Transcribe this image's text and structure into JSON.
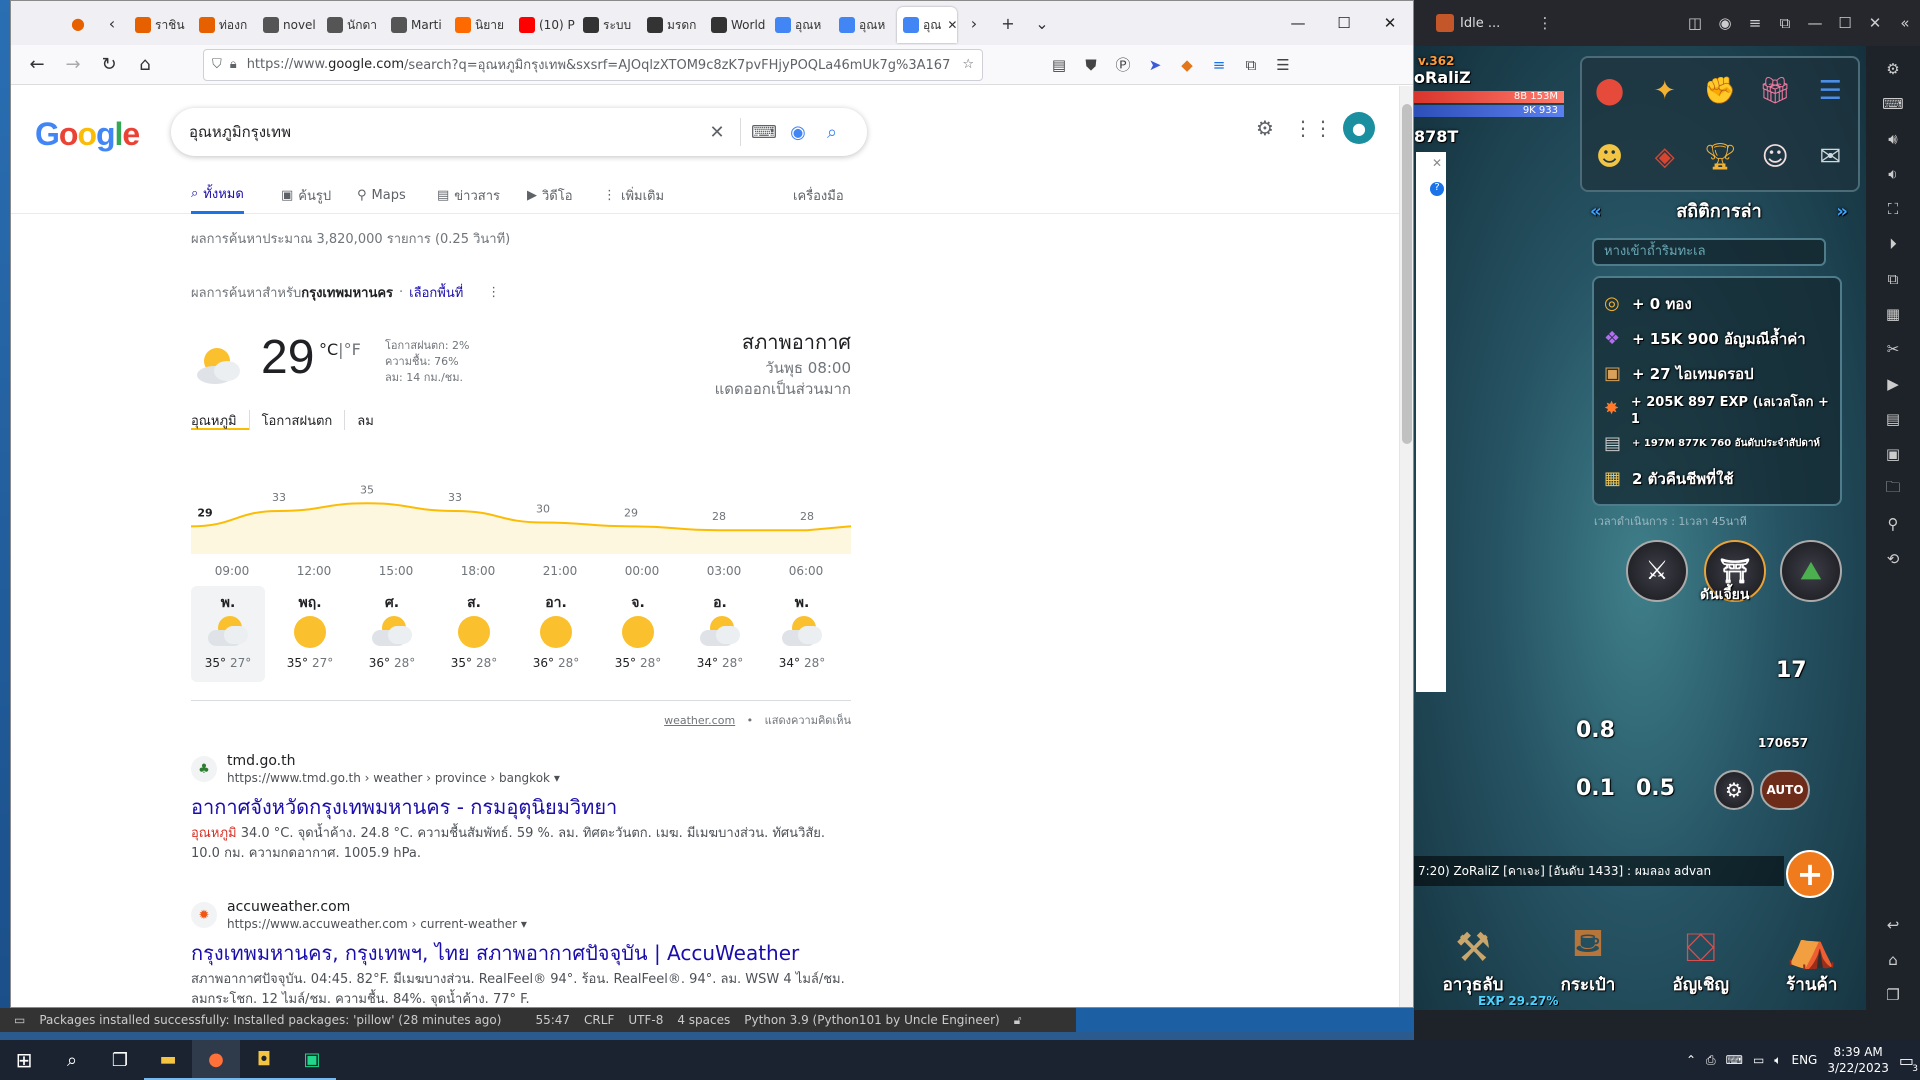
{
  "browser": {
    "tabs": [
      {
        "label": "ราชิน",
        "color": "#e66000"
      },
      {
        "label": "ท่องก",
        "color": "#e66000"
      },
      {
        "label": "novel",
        "color": "#555"
      },
      {
        "label": "นักดา",
        "color": "#555"
      },
      {
        "label": "Marti",
        "color": "#555"
      },
      {
        "label": "นิยาย",
        "color": "#ff6a00"
      },
      {
        "label": "(10) P",
        "color": "#ff0000"
      },
      {
        "label": "ระบบ",
        "color": "#333"
      },
      {
        "label": "มรดก",
        "color": "#333"
      },
      {
        "label": "World",
        "color": "#333"
      },
      {
        "label": "อุณห",
        "color": "#4285f4"
      },
      {
        "label": "อุณห",
        "color": "#4285f4"
      },
      {
        "label": "อุณ",
        "color": "#4285f4"
      }
    ],
    "url_prefix": "https://www.",
    "url_domain": "google.com",
    "url_rest": "/search?q=อุณหภูมิกรุงเทพ&sxsrf=AJOqlzXTOM9c8zK7pvFHjyPOQLa46mUk7g%3A167"
  },
  "google": {
    "logo": [
      "G",
      "o",
      "o",
      "g",
      "l",
      "e"
    ],
    "logo_colors": [
      "#4285f4",
      "#ea4335",
      "#fbbc05",
      "#4285f4",
      "#34a853",
      "#ea4335"
    ],
    "query": "อุณหภูมิกรุงเทพ",
    "tabs": [
      "ทั้งหมด",
      "ค้นรูป",
      "Maps",
      "ข่าวสาร",
      "วิดีโอ",
      "เพิ่มเติม"
    ],
    "tools": "เครื่องมือ",
    "stats": "ผลการค้นหาประมาณ 3,820,000 รายการ (0.25 วินาที)",
    "loc_prefix": "ผลการค้นหาสำหรับ",
    "loc_place": "กรุงเทพมหานคร",
    "loc_sep": "·",
    "loc_link": "เลือกพื้นที่"
  },
  "weather": {
    "temp": "29",
    "unit_c": "°C",
    "unit_sep": "|",
    "unit_f": "°F",
    "precip": "โอกาสฝนตก: 2%",
    "humidity": "ความชื้น: 76%",
    "wind": "ลม: 14 กม./ชม.",
    "title": "สภาพอากาศ",
    "day": "วันพุธ 08:00",
    "condition": "แดดออกเป็นส่วนมาก",
    "subtabs": [
      "อุณหภูมิ",
      "โอกาสฝนตก",
      "ลม"
    ],
    "source": "weather.com",
    "feedback": "แสดงความคิดเห็น",
    "days": [
      {
        "name": "พ.",
        "icon": "partly-cloudy",
        "hi": "35°",
        "lo": "27°"
      },
      {
        "name": "พฤ.",
        "icon": "sunny",
        "hi": "35°",
        "lo": "27°"
      },
      {
        "name": "ศ.",
        "icon": "partly-cloudy",
        "hi": "36°",
        "lo": "28°"
      },
      {
        "name": "ส.",
        "icon": "sunny",
        "hi": "35°",
        "lo": "28°"
      },
      {
        "name": "อา.",
        "icon": "sunny",
        "hi": "36°",
        "lo": "28°"
      },
      {
        "name": "จ.",
        "icon": "sunny",
        "hi": "35°",
        "lo": "28°"
      },
      {
        "name": "อ.",
        "icon": "partly-cloudy",
        "hi": "34°",
        "lo": "28°"
      },
      {
        "name": "พ.",
        "icon": "partly-cloudy",
        "hi": "34°",
        "lo": "28°"
      }
    ]
  },
  "chart_data": {
    "type": "area",
    "x": [
      "09:00",
      "12:00",
      "15:00",
      "18:00",
      "21:00",
      "00:00",
      "03:00",
      "06:00"
    ],
    "values": [
      29,
      33,
      35,
      33,
      30,
      29,
      28,
      28
    ],
    "ylim": [
      20,
      40
    ],
    "color": "#fbbc04"
  },
  "results": [
    {
      "site": "tmd.go.th",
      "url": "https://www.tmd.go.th › weather › province › bangkok",
      "title": "อากาศจังหวัดกรุงเทพมหานคร - กรมอุตุนิยมวิทยา",
      "snip_em": "อุณหภูมิ",
      "snippet": " 34.0 °C. จุดน้ำค้าง. 24.8 °C. ความชื้นสัมพัทธ์. 59 %. ลม. ทิศตะวันตก. เมฆ. มีเมฆบางส่วน. ทัศนวิสัย. 10.0 กม. ความกดอากาศ. 1005.9 hPa."
    },
    {
      "site": "accuweather.com",
      "url": "https://www.accuweather.com › current-weather",
      "title": "กรุงเทพมหานคร, กรุงเทพฯ, ไทย สภาพอากาศปัจจุบัน | AccuWeather",
      "snip_em": "",
      "snippet": "สภาพอากาศปัจจุบัน. 04:45. 82°F. มีเมฆบางส่วน. RealFeel® 94°. ร้อน. RealFeel®. 94°. ลม. WSW 4 ไมล์/ชม. ลมกระโชก. 12 ไมล์/ชม. ความชื้น. 84%. จุดน้ำค้าง. 77° F."
    }
  ],
  "statusbar": {
    "message": "Packages installed successfully: Installed packages: 'pillow' (28 minutes ago)",
    "position": "55:47",
    "eol": "CRLF",
    "encoding": "UTF-8",
    "indent": "4 spaces",
    "interpreter": "Python 3.9 (Python101 by Uncle Engineer)"
  },
  "emulator": {
    "title": "Idle ...",
    "level": "v.362",
    "player": "oRaliZ",
    "hp": "8B 153M",
    "mp": "9K 933",
    "power": "878T",
    "panel_title": "สถิติการล่า",
    "panel_location": "หางเข้าถ้ำริมทะเล",
    "loot": [
      "+ 0 ทอง",
      "+ 15K 900 อัญมณีล้ำค่า",
      "+ 27 ไอเทมดรอป",
      "+ 205K 897 EXP (เลเวลโลก + 1",
      "+ 197M 877K 760 อันดับประจำสัปดาห์",
      "2 ตัวคืนชีพที่ใช้"
    ],
    "elapsed": "เวลาดำเนินการ : 1เวลา 45นาที",
    "dungeon": "ดันเจี้ยน",
    "speed1": "0.8",
    "speed2": "0.1",
    "speed3": "0.5",
    "count": "17",
    "damage": "170657",
    "auto": "AUTO",
    "chat": "7:20) ZoRaliZ [คาเจะ] [อันดับ 1433] : ผมลอง advan",
    "nav": [
      "อาวุธลับ",
      "กระเป๋า",
      "อัญเชิญ",
      "ร้านค้า"
    ],
    "exp": "EXP 29.27%"
  },
  "taskbar": {
    "lang": "ENG",
    "time": "8:39 AM",
    "date": "3/22/2023",
    "notif": "3"
  }
}
